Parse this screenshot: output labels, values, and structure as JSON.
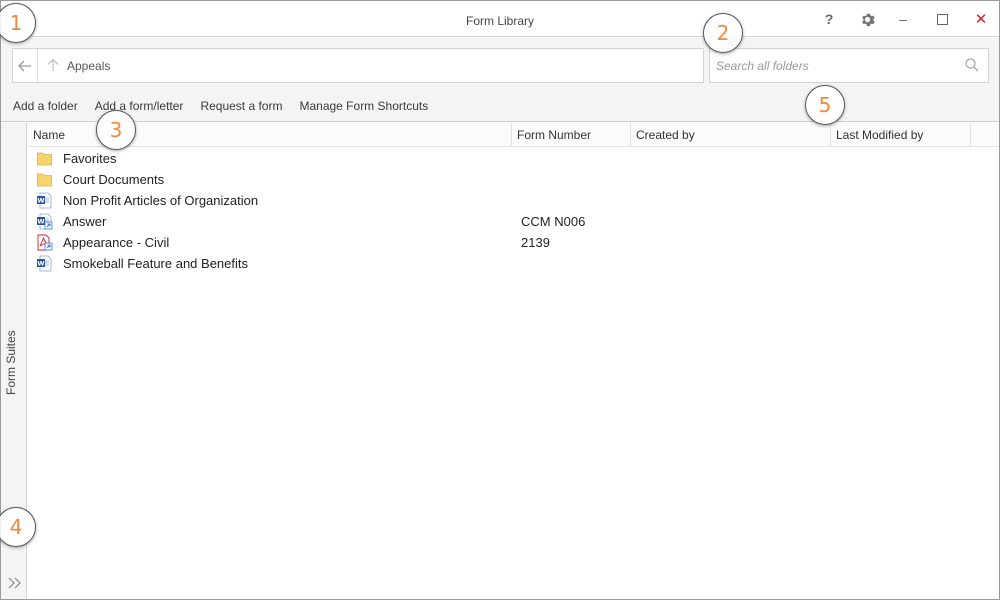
{
  "window": {
    "title": "Form Library",
    "controls": {
      "help": "?",
      "minimize": "–",
      "close": "✕"
    }
  },
  "nav": {
    "path": "Appeals"
  },
  "search": {
    "placeholder": "Search all folders",
    "value": ""
  },
  "actions": [
    {
      "label": "Add a folder"
    },
    {
      "label": "Add a form/letter"
    },
    {
      "label": "Request a form"
    },
    {
      "label": "Manage Form Shortcuts"
    }
  ],
  "sidebar": {
    "label": "Form Suites"
  },
  "table": {
    "columns": [
      "Name",
      "Form Number",
      "Created by",
      "Last Modified by"
    ],
    "rows": [
      {
        "name": "Favorites",
        "form_number": "",
        "type": "folder-icon"
      },
      {
        "name": "Court Documents",
        "form_number": "",
        "type": "folder-icon"
      },
      {
        "name": "Non Profit Articles of Organization",
        "form_number": "",
        "type": "word-doc-icon"
      },
      {
        "name": "Answer",
        "form_number": "CCM N006",
        "type": "word-doc-shortcut-icon"
      },
      {
        "name": "Appearance - Civil",
        "form_number": "2139",
        "type": "pdf-shortcut-icon"
      },
      {
        "name": "Smokeball Feature and Benefits",
        "form_number": "",
        "type": "word-doc-icon"
      }
    ]
  },
  "callouts": [
    "1",
    "2",
    "3",
    "4",
    "5"
  ],
  "colors": {
    "accent": "#f08a40",
    "close": "#d0202a",
    "folder": "#f7d36b",
    "word": "#2b579a",
    "pdf": "#d0202a",
    "shortcut": "#3a7bd5"
  }
}
